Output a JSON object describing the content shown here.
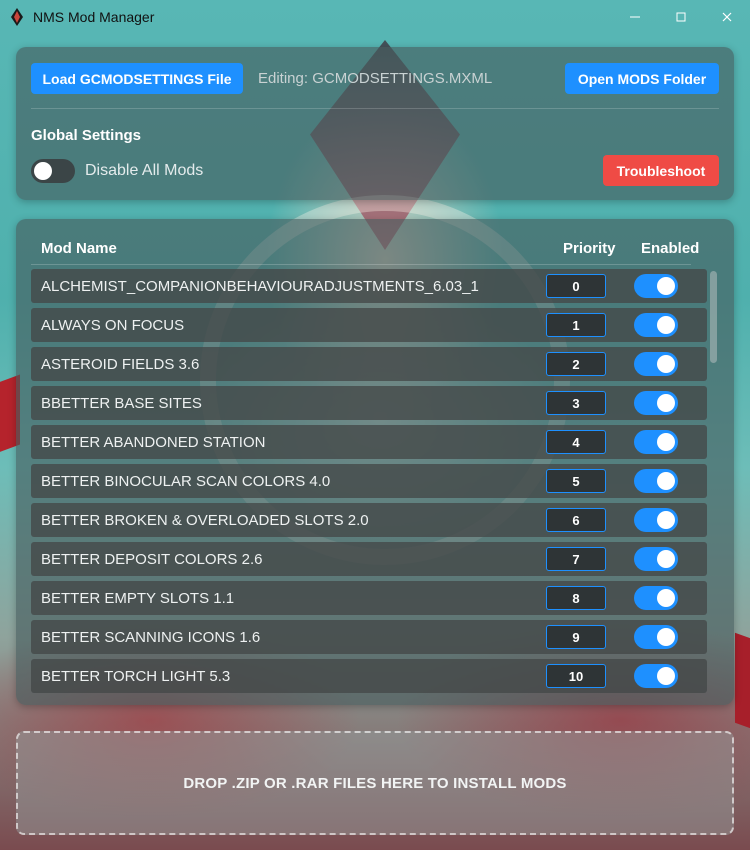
{
  "window": {
    "title": "NMS Mod Manager",
    "minimize": "—",
    "maximize": "☐",
    "close": "✕"
  },
  "toolbar": {
    "load_label": "Load GCMODSETTINGS File",
    "editing_text": "Editing: GCMODSETTINGS.MXML",
    "open_label": "Open MODS Folder"
  },
  "global": {
    "heading": "Global Settings",
    "disable_label": "Disable All Mods",
    "disable_on": false,
    "troubleshoot_label": "Troubleshoot"
  },
  "list": {
    "col_name": "Mod Name",
    "col_priority": "Priority",
    "col_enabled": "Enabled",
    "mods": [
      {
        "name": "ALCHEMIST_COMPANIONBEHAVIOURADJUSTMENTS_6.03_1",
        "priority": "0",
        "enabled": true
      },
      {
        "name": "ALWAYS ON FOCUS",
        "priority": "1",
        "enabled": true
      },
      {
        "name": "ASTEROID FIELDS 3.6",
        "priority": "2",
        "enabled": true
      },
      {
        "name": "BBETTER BASE SITES",
        "priority": "3",
        "enabled": true
      },
      {
        "name": "BETTER ABANDONED STATION",
        "priority": "4",
        "enabled": true
      },
      {
        "name": "BETTER BINOCULAR SCAN COLORS 4.0",
        "priority": "5",
        "enabled": true
      },
      {
        "name": "BETTER BROKEN & OVERLOADED SLOTS 2.0",
        "priority": "6",
        "enabled": true
      },
      {
        "name": "BETTER DEPOSIT COLORS 2.6",
        "priority": "7",
        "enabled": true
      },
      {
        "name": "BETTER EMPTY SLOTS 1.1",
        "priority": "8",
        "enabled": true
      },
      {
        "name": "BETTER SCANNING ICONS 1.6",
        "priority": "9",
        "enabled": true
      },
      {
        "name": "BETTER TORCH LIGHT 5.3",
        "priority": "10",
        "enabled": true
      }
    ]
  },
  "dropzone": {
    "text": "DROP .ZIP OR .RAR FILES HERE TO INSTALL MODS"
  },
  "colors": {
    "accent": "#1e90ff",
    "danger": "#ef4b45"
  }
}
